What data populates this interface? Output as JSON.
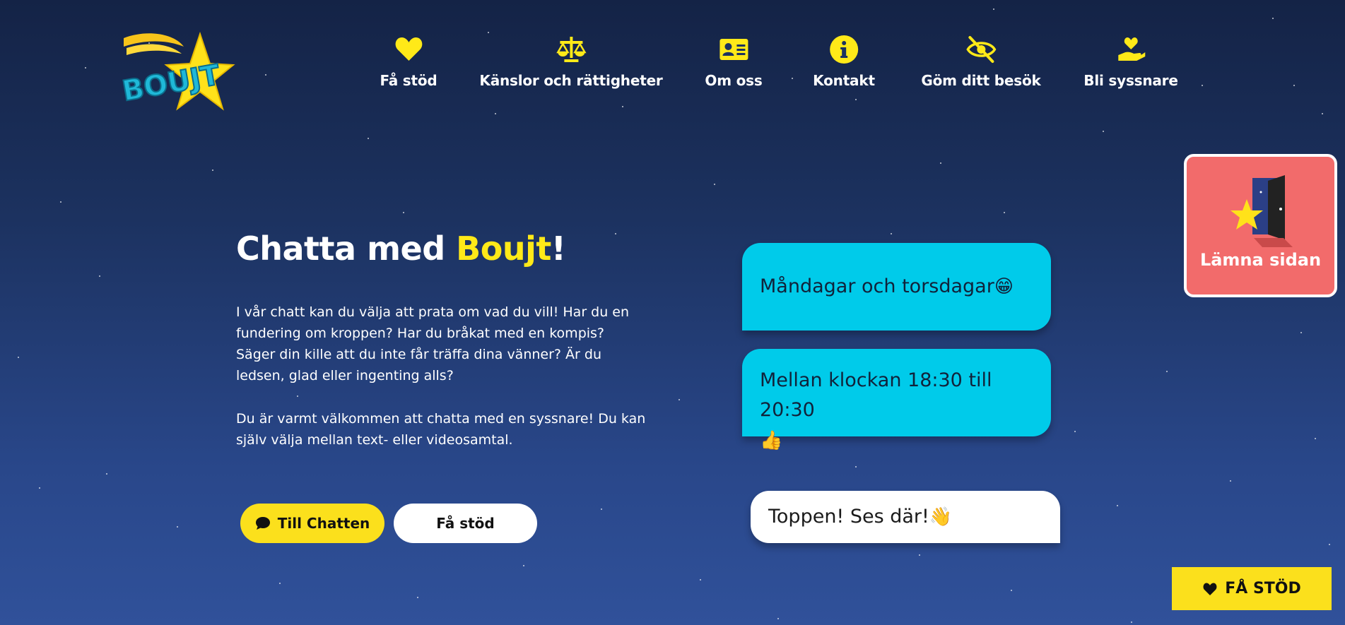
{
  "brand": {
    "logo_text": "BOUJT",
    "colors": {
      "accent_yellow": "#fbe01c",
      "bubble_cyan": "#00cbea",
      "leave_red": "#f26b6b",
      "bg_dark": "#142346"
    }
  },
  "nav": {
    "items": [
      {
        "label": "Få stöd",
        "icon": "heart-icon"
      },
      {
        "label": "Känslor och rättigheter",
        "icon": "scale-icon"
      },
      {
        "label": "Om oss",
        "icon": "id-card-icon"
      },
      {
        "label": "Kontakt",
        "icon": "info-icon"
      },
      {
        "label": "Göm ditt besök",
        "icon": "eye-slash-icon"
      },
      {
        "label": "Bli syssnare",
        "icon": "hand-heart-icon"
      }
    ]
  },
  "hero": {
    "title_prefix": "Chatta med ",
    "title_accent": "Boujt",
    "title_suffix": "!",
    "paragraph_1": "I vår chatt kan du välja att prata om vad du vill! Har du en fundering om kroppen? Har du bråkat med en kompis? Säger din kille att du inte får träffa dina vänner? Är du ledsen, glad eller ingenting alls?",
    "paragraph_2": "Du är varmt välkommen att chatta med en syssnare! Du kan själv välja mellan text- eller videosamtal."
  },
  "buttons": {
    "chat_label": "Till Chatten",
    "stod_label": "Få stöd"
  },
  "chat": {
    "bubble_1": "Måndagar och torsdagar",
    "bubble_1_emoji": "😁",
    "bubble_2": "Mellan klockan 18:30 till 20:30",
    "bubble_2_emoji": "👍",
    "bubble_3": "Toppen! Ses där!",
    "bubble_3_emoji": "👋"
  },
  "leave": {
    "label": "Lämna sidan"
  },
  "cta": {
    "label": "FÅ STÖD"
  }
}
